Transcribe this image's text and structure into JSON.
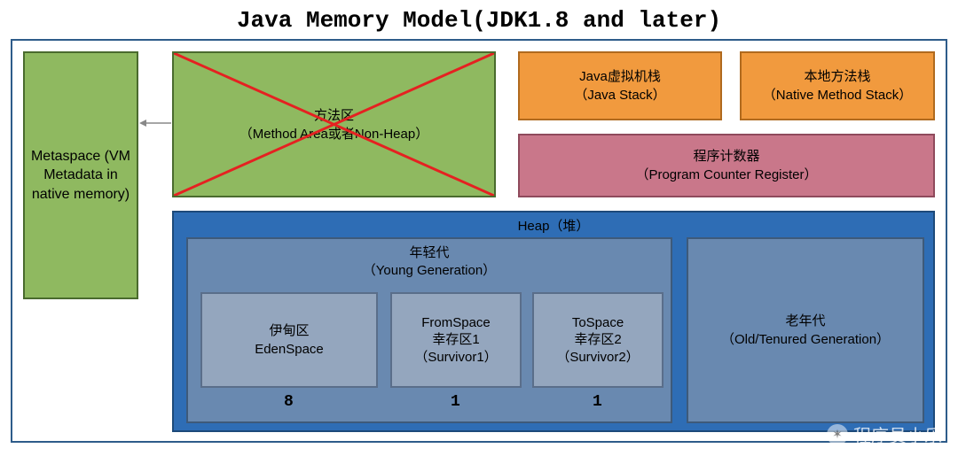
{
  "title": "Java Memory Model(JDK1.8 and later)",
  "metaspace": {
    "label": "Metaspace (VM Metadata in native memory)"
  },
  "method_area": {
    "line1": "方法区",
    "line2": "（Method Area或者Non-Heap）"
  },
  "java_stack": {
    "line1": "Java虚拟机栈",
    "line2": "（Java Stack）"
  },
  "native_stack": {
    "line1": "本地方法栈",
    "line2": "（Native Method Stack）"
  },
  "pc_register": {
    "line1": "程序计数器",
    "line2": "（Program Counter Register）"
  },
  "heap": {
    "title": "Heap（堆）",
    "young": {
      "line1": "年轻代",
      "line2": "（Young Generation）",
      "eden": {
        "line1": "伊甸区",
        "line2": "EdenSpace"
      },
      "survivor1": {
        "line1": "FromSpace",
        "line2": "幸存区1",
        "line3": "（Survivor1）"
      },
      "survivor2": {
        "line1": "ToSpace",
        "line2": "幸存区2",
        "line3": "（Survivor2）"
      },
      "ratio": {
        "eden": "8",
        "s1": "1",
        "s2": "1"
      }
    },
    "old": {
      "line1": "老年代",
      "line2": "（Old/Tenured Generation）"
    }
  },
  "watermark": "程序员小乐",
  "colors": {
    "green": "#8fb960",
    "orange": "#f19a3e",
    "pink": "#c9778a",
    "blue": "#2e6db5",
    "slate": "#6989b0",
    "lightslate": "#94a6be",
    "red": "#e52121"
  }
}
